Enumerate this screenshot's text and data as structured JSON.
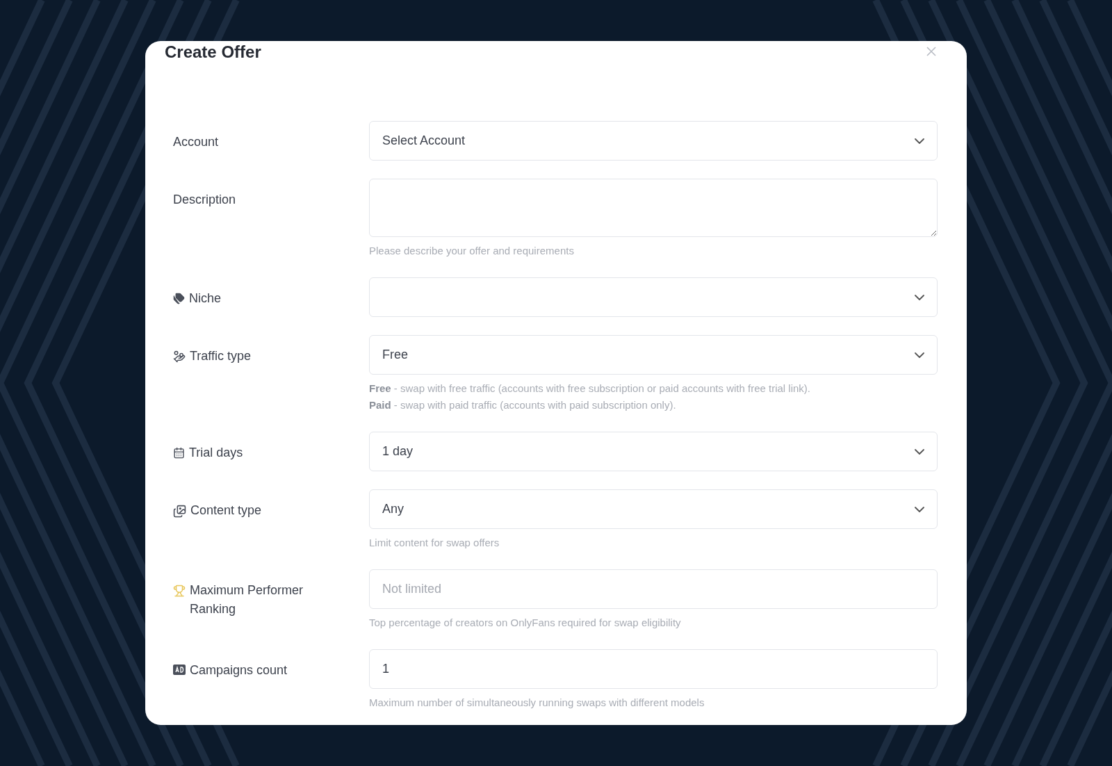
{
  "dialog": {
    "title": "Create Offer"
  },
  "fields": [
    {
      "label": "Account",
      "kind": "select",
      "value": "Select Account"
    },
    {
      "label": "Description",
      "kind": "textarea",
      "hints": [
        "Please describe your offer and requirements"
      ]
    },
    {
      "label": "Niche",
      "kind": "select"
    },
    {
      "label": "Traffic type",
      "kind": "select",
      "value": "Free",
      "hints": [
        "**Free** - swap with free traffic (accounts with free subscription or paid accounts with free trial link).",
        "**Paid** - swap with paid traffic (accounts with paid subscription only)."
      ]
    },
    {
      "label": "Trial days",
      "kind": "select",
      "value": "1 day"
    },
    {
      "label": "Content type",
      "kind": "select",
      "value": "Any",
      "hints": [
        "Limit content for swap offers"
      ]
    },
    {
      "label": "Maximum Performer Ranking",
      "kind": "input",
      "placeholder": "Not limited",
      "hints": [
        "Top percentage of creators on OnlyFans required for swap eligibility"
      ]
    },
    {
      "label": "Campaigns count",
      "kind": "input",
      "value": "1",
      "hints": [
        "Maximum number of simultaneously running swaps with different models"
      ]
    }
  ]
}
